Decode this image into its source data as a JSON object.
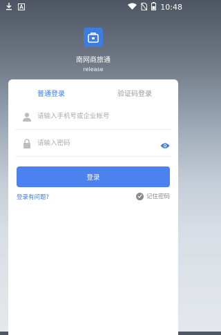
{
  "status": {
    "time": "10:48"
  },
  "app": {
    "name": "南网商旅通",
    "variant": "release",
    "icon_color": "#3d7de0"
  },
  "tabs": {
    "normal_login": "普通登录",
    "code_login": "验证码登录"
  },
  "fields": {
    "account_placeholder": "请输入手机号或企业帐号",
    "password_placeholder": "请输入密码"
  },
  "actions": {
    "login": "登录",
    "help": "登录有问题?",
    "remember": "记住密码"
  },
  "colors": {
    "accent": "#3d7de0",
    "button": "#4c82f0"
  }
}
